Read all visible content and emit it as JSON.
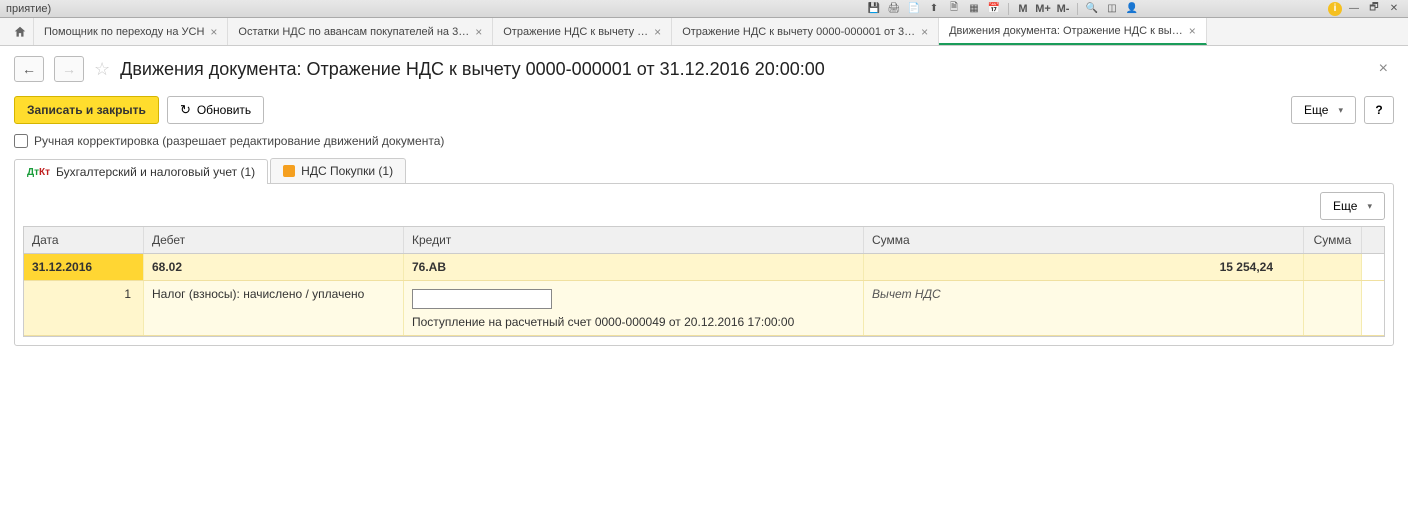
{
  "window": {
    "title": "приятие)"
  },
  "titlebar_icons": [
    "save",
    "print",
    "copy",
    "export",
    "preview",
    "grid",
    "calendar"
  ],
  "titlebar_m": [
    "M",
    "M+",
    "M-"
  ],
  "tabs": [
    {
      "label": "Помощник по переходу на УСН"
    },
    {
      "label": "Остатки НДС по авансам покупателей на 3…"
    },
    {
      "label": "Отражение НДС к вычету …"
    },
    {
      "label": "Отражение НДС к вычету 0000-000001 от 3…"
    },
    {
      "label": "Движения документа: Отражение НДС к вы…",
      "active": true
    }
  ],
  "page": {
    "title": "Движения документа: Отражение НДС к вычету 0000-000001 от 31.12.2016 20:00:00"
  },
  "toolbar": {
    "save_close": "Записать и закрыть",
    "refresh": "Обновить",
    "more": "Еще",
    "help": "?"
  },
  "checkbox": {
    "label": "Ручная корректировка (разрешает редактирование движений документа)"
  },
  "subtabs": [
    {
      "label": "Бухгалтерский и налоговый учет (1)",
      "active": true
    },
    {
      "label": "НДС Покупки (1)"
    }
  ],
  "grid": {
    "headers": {
      "date": "Дата",
      "debit": "Дебет",
      "credit": "Кредит",
      "sum": "Сумма",
      "sum2": "Сумма"
    },
    "rows": [
      {
        "date": "31.12.2016",
        "debit": "68.02",
        "credit": "76.АВ",
        "amount": "15 254,24"
      },
      {
        "num": "1",
        "debit_text": "Налог (взносы): начислено / уплачено",
        "credit_text": "Поступление на расчетный счет 0000-000049 от 20.12.2016 17:00:00",
        "sum_text": "Вычет НДС"
      }
    ]
  }
}
